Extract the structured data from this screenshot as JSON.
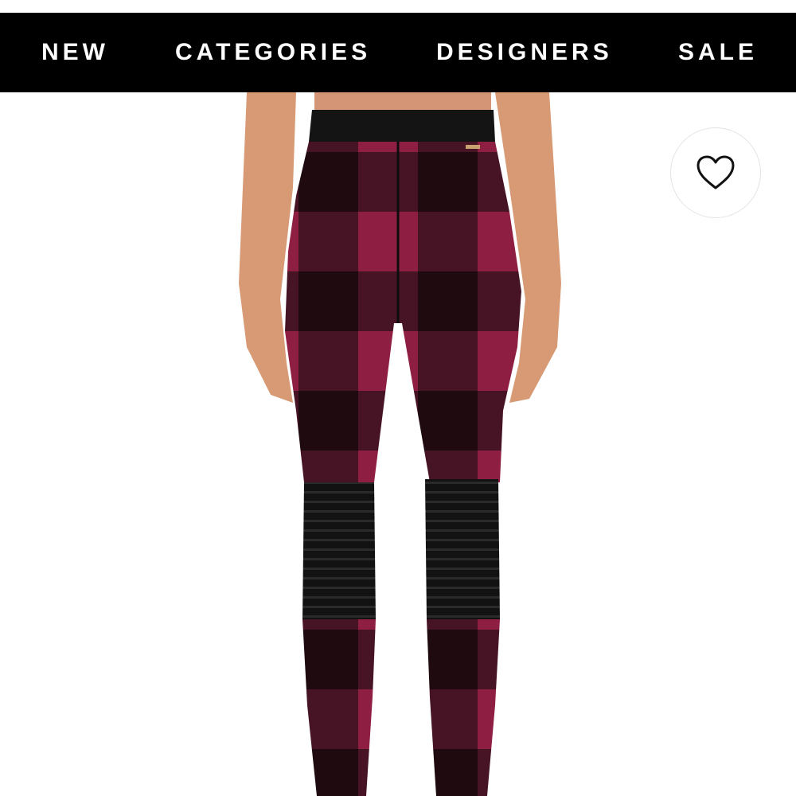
{
  "nav": {
    "items": [
      {
        "label": "NEW"
      },
      {
        "label": "CATEGORIES"
      },
      {
        "label": "DESIGNERS"
      },
      {
        "label": "SALE"
      }
    ]
  },
  "product": {
    "image_icon": "product-photo-leggings-back-view",
    "colors": {
      "plaid_light": "#8e1f42",
      "plaid_dark": "#2a0f16",
      "waistband": "#141414",
      "skin": "#d79a74"
    }
  },
  "favorite": {
    "icon": "heart-outline-icon"
  }
}
